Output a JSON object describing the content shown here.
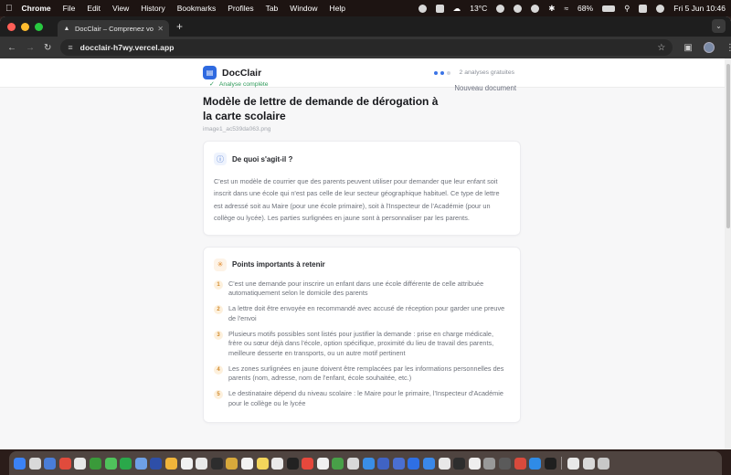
{
  "menubar": {
    "app": "Chrome",
    "items": [
      "File",
      "Edit",
      "View",
      "History",
      "Bookmarks",
      "Profiles",
      "Tab",
      "Window",
      "Help"
    ],
    "weather": "13°C",
    "battery": "68%",
    "clock": "Fri 5 Jun  10:46"
  },
  "browser": {
    "tab_title": "DocClair – Comprenez vos do",
    "url": "docclair-h7wy.vercel.app"
  },
  "header": {
    "brand": "DocClair",
    "quota": "2 analyses gratuites"
  },
  "main": {
    "status": "Analyse complète",
    "new_doc": "Nouveau document",
    "title": "Modèle de lettre de demande de dérogation à la carte scolaire",
    "filename": "image1_ac539da063.png",
    "about": {
      "title": "De quoi s'agit-il ?",
      "text": "C'est un modèle de courrier que des parents peuvent utiliser pour demander que leur enfant soit inscrit dans une école qui n'est pas celle de leur secteur géographique habituel. Ce type de lettre est adressé soit au Maire (pour une école primaire), soit à l'Inspecteur de l'Académie (pour un collège ou lycée). Les parties surlignées en jaune sont à personnaliser par les parents."
    },
    "points": {
      "title": "Points importants à retenir",
      "items": [
        {
          "n": "1",
          "text": "C'est une demande pour inscrire un enfant dans une école différente de celle attribuée automatiquement selon le domicile des parents"
        },
        {
          "n": "2",
          "text": "La lettre doit être envoyée en recommandé avec accusé de réception pour garder une preuve de l'envoi"
        },
        {
          "n": "3",
          "text": "Plusieurs motifs possibles sont listés pour justifier la demande : prise en charge médicale, frère ou sœur déjà dans l'école, option spécifique, proximité du lieu de travail des parents, meilleure desserte en transports, ou un autre motif pertinent"
        },
        {
          "n": "4",
          "text": "Les zones surlignées en jaune doivent être remplacées par les informations personnelles des parents (nom, adresse, nom de l'enfant, école souhaitée, etc.)"
        },
        {
          "n": "5",
          "text": "Le destinataire dépend du niveau scolaire : le Maire pour le primaire, l'Inspecteur d'Académie pour le collège ou le lycée"
        }
      ]
    }
  },
  "colors": {
    "accent": "#2f6ae0",
    "success": "#2f9a5a",
    "warm": "#d18a2d"
  },
  "dock_apps": [
    "#3b82f6",
    "#d9d9d9",
    "#4a7dd8",
    "#e04b3c",
    "#e8e8e8",
    "#3a9a3a",
    "#4fc35b",
    "#2aa84a",
    "#6ea0e6",
    "#2e4fa8",
    "#f0b43a",
    "#f1f1f1",
    "#e9e9e9",
    "#2d2d2d",
    "#d8a93b",
    "#f2f2f2",
    "#f3d55b",
    "#e9e9e9",
    "#222",
    "#e6483c",
    "#f0f0f0",
    "#48a048",
    "#d8d8d8",
    "#3a8ee6",
    "#4063c4",
    "#4a6fd1",
    "#2e6fe4",
    "#3a88e8",
    "#e8e8e8",
    "#2d2d2d",
    "#eee",
    "#999",
    "#5a5a5a",
    "#d94a3c",
    "#2f8be6",
    "#1f1f1f",
    "#e8e8e8",
    "#d9d9d9",
    "#c7c7c7"
  ]
}
